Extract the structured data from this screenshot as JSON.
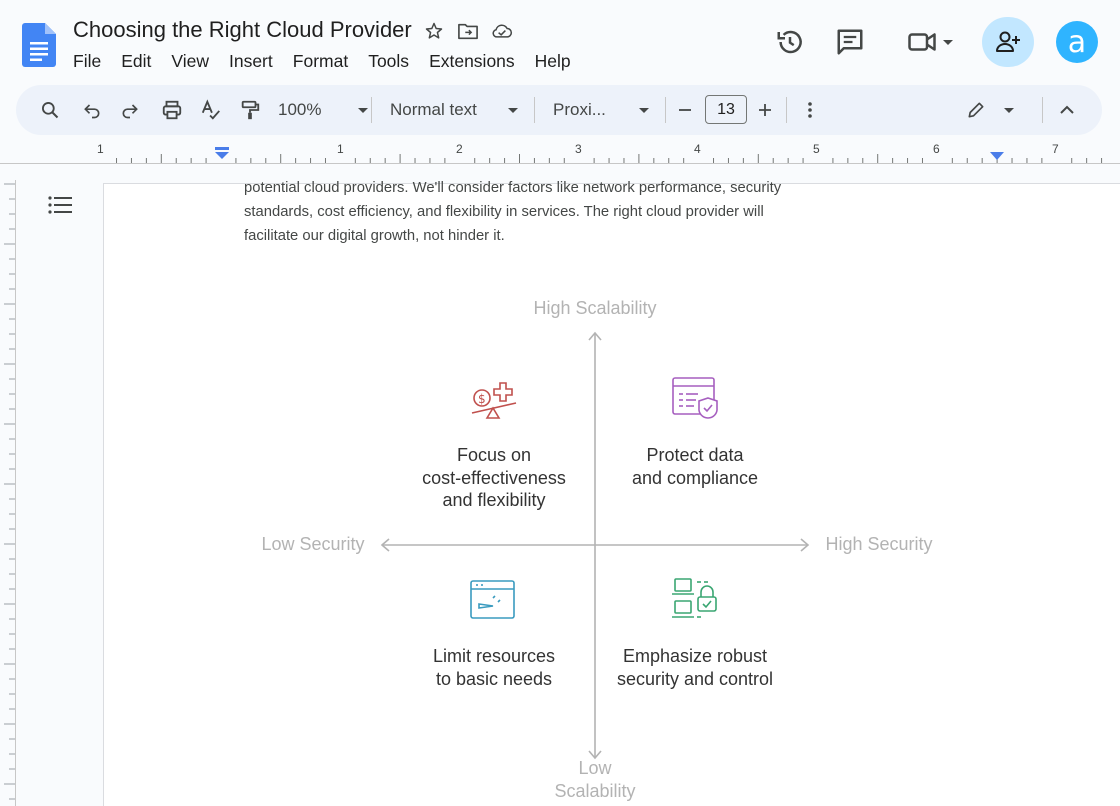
{
  "document": {
    "title": "Choosing the Right Cloud Provider"
  },
  "menu": [
    "File",
    "Edit",
    "View",
    "Insert",
    "Format",
    "Tools",
    "Extensions",
    "Help"
  ],
  "toolbar": {
    "zoom": "100%",
    "style": "Normal text",
    "font": "Proxi...",
    "font_size": "13"
  },
  "account": {
    "avatar_letter": "a"
  },
  "ruler": {
    "numbers": [
      "1",
      "1",
      "2",
      "3",
      "4",
      "5",
      "6",
      "7"
    ]
  },
  "body": {
    "paragraph_lines": [
      "potential cloud providers. We'll consider factors like network performance, security",
      "standards, cost efficiency, and flexibility in services. The right cloud provider will",
      "facilitate our digital growth, not hinder it."
    ]
  },
  "diagram": {
    "y_axis_top": "High Scalability",
    "y_axis_bottom_line1": "Low",
    "y_axis_bottom_line2": "Scalability",
    "x_axis_left": "Low Security",
    "x_axis_right": "High Security",
    "quadrants": {
      "top_left": {
        "lines": [
          "Focus on",
          "cost-effectiveness",
          "and flexibility"
        ],
        "icon": "cost-balance-icon",
        "color": "#c0504d"
      },
      "top_right": {
        "lines": [
          "Protect data",
          "and compliance"
        ],
        "icon": "shield-document-icon",
        "color": "#a65fbf"
      },
      "bottom_left": {
        "lines": [
          "Limit resources",
          "to basic needs"
        ],
        "icon": "browser-window-icon",
        "color": "#3a9bbf"
      },
      "bottom_right": {
        "lines": [
          "Emphasize robust",
          "security and control"
        ],
        "icon": "secure-devices-icon",
        "color": "#3aa672"
      }
    }
  },
  "colors": {
    "toolbar_bg": "#edf2fa",
    "share_bg": "#c2e7ff",
    "avatar_bg": "#2fb4ff",
    "docs_blue": "#4285f4",
    "axis_gray": "#b3b3b3"
  }
}
